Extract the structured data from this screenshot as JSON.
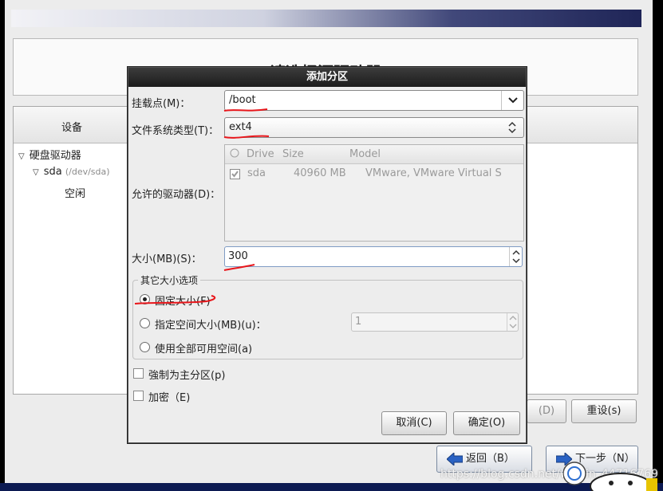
{
  "installer": {
    "heading": "请选择源驱动器",
    "tree_header": "设备",
    "tree": [
      {
        "label": "硬盘驱动器"
      },
      {
        "label": "sda",
        "sub": "(/dev/sda)"
      },
      {
        "label": "空闲"
      }
    ],
    "bg_buttons": {
      "delete_label": "(D)",
      "reset_label": "重设(s)"
    },
    "nav": {
      "back_label": "返回（B）",
      "next_label": "下一步（N）"
    },
    "watermark": "https://blog.csdn.net/weixin_44716769"
  },
  "dialog": {
    "title": "添加分区",
    "mount_label": "挂载点(M)：",
    "mount_value": "/boot",
    "fstype_label": "文件系统类型(T)：",
    "fstype_value": "ext4",
    "drives_label": "允许的驱动器(D)：",
    "drives_columns": [
      "Drive",
      "Size",
      "Model"
    ],
    "drives_rows": [
      {
        "drive": "sda",
        "size": "40960 MB",
        "model": "VMware, VMware Virtual S",
        "checked": true
      }
    ],
    "size_label": "大小(MB)(S)：",
    "size_value": "300",
    "other_group_title": "其它大小选项",
    "options": [
      {
        "label": "固定大小(F)",
        "selected": true
      },
      {
        "label": "指定空间大小(MB)(u)：",
        "selected": false
      },
      {
        "label": "使用全部可用空间(a)",
        "selected": false
      }
    ],
    "max_size_value": "1",
    "force_primary_label": "強制为主分区(p)",
    "encrypt_label": "加密（E)",
    "cancel_label": "取消(C)",
    "ok_label": "确定(O)"
  },
  "colors": {
    "title_bar": "#2a2a2a",
    "annotation": "#e8161b",
    "footer": "#0c1a52"
  }
}
